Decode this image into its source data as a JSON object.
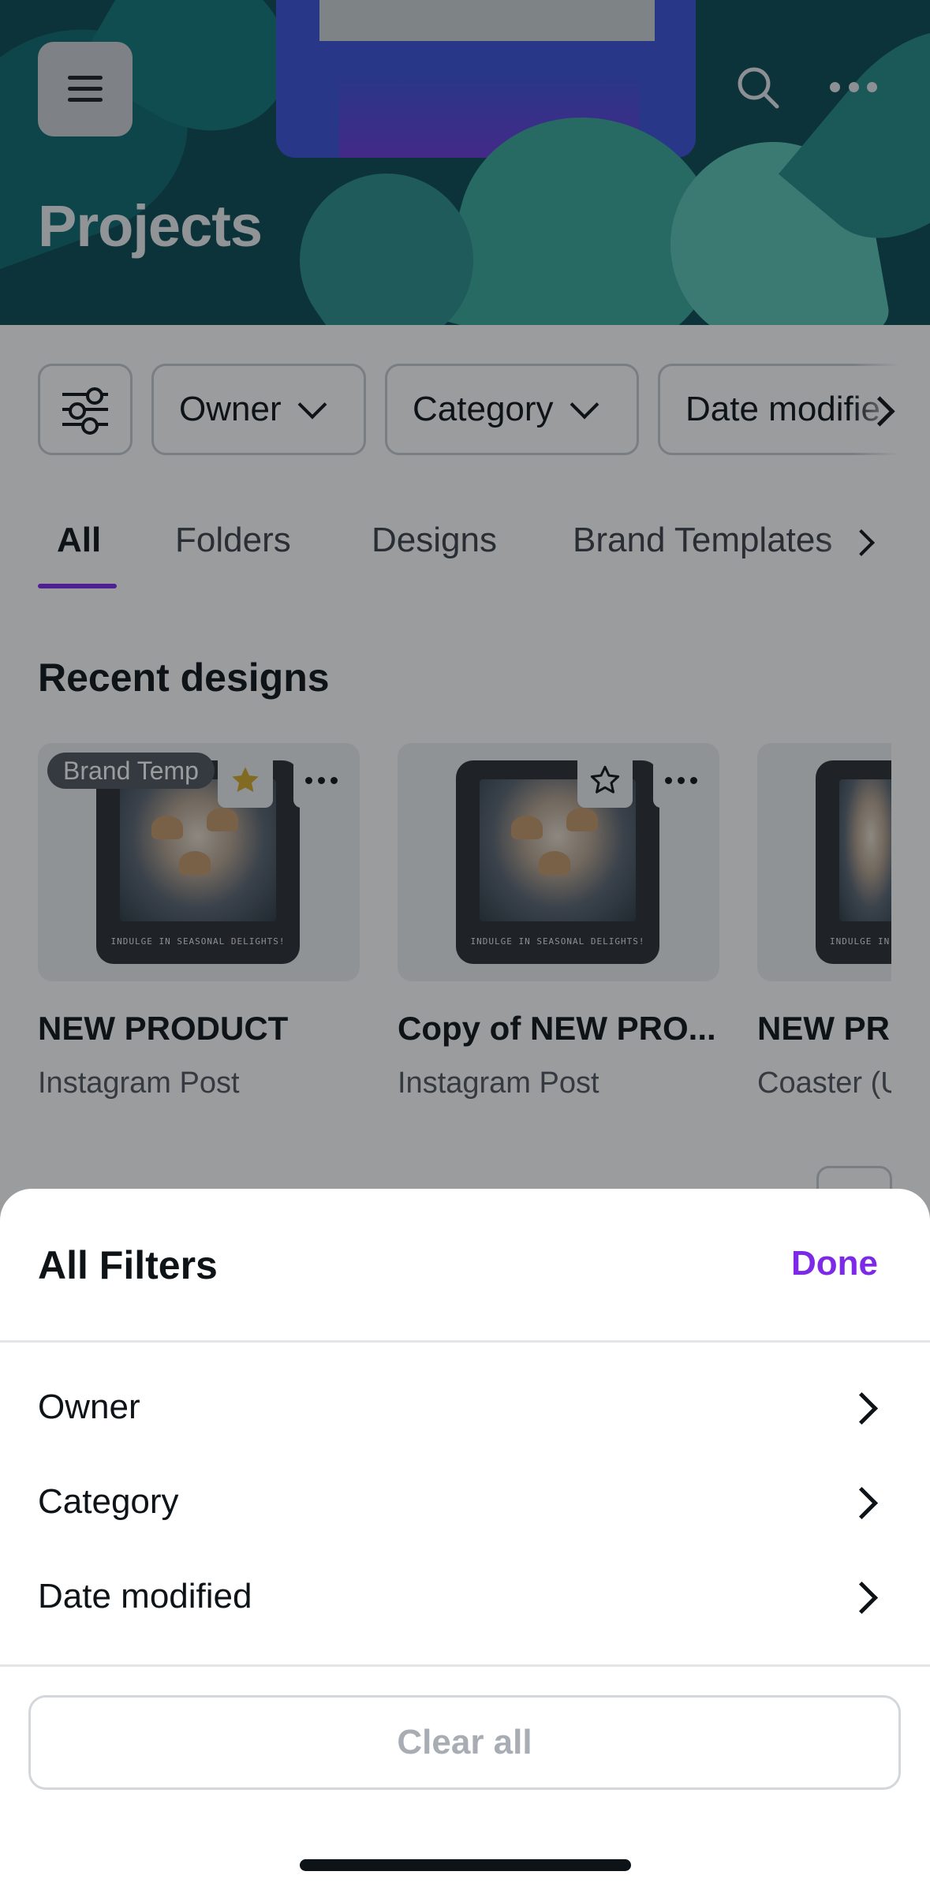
{
  "header": {
    "title": "Projects",
    "menu_icon": "hamburger-menu-icon",
    "search_icon": "search-icon",
    "more_icon": "more-horizontal-icon"
  },
  "filters": {
    "filter_icon": "sliders-icon",
    "chips": [
      {
        "label": "Owner"
      },
      {
        "label": "Category"
      },
      {
        "label": "Date modifie"
      }
    ]
  },
  "tabs": {
    "items": [
      {
        "label": "All",
        "active": true
      },
      {
        "label": "Folders"
      },
      {
        "label": "Designs"
      },
      {
        "label": "Brand Templates"
      }
    ],
    "accent_color": "#7d2ae8"
  },
  "recent": {
    "title": "Recent designs",
    "cards": [
      {
        "title": "NEW PRODUCT",
        "type": "Instagram Post",
        "badge": "Brand Temp",
        "starred": true,
        "caption": "INDULGE IN SEASONAL DELIGHTS!"
      },
      {
        "title": "Copy of NEW PRO...",
        "type": "Instagram Post",
        "starred": false,
        "caption": "INDULGE IN SEASONAL DELIGHTS!"
      },
      {
        "title": "NEW PR",
        "type": "Coaster (U",
        "caption": "INDULGE IN"
      }
    ]
  },
  "sheet": {
    "title": "All Filters",
    "done_label": "Done",
    "rows": [
      {
        "label": "Owner"
      },
      {
        "label": "Category"
      },
      {
        "label": "Date modified"
      }
    ],
    "clear_label": "Clear all",
    "star_color": "#d4a92a"
  }
}
